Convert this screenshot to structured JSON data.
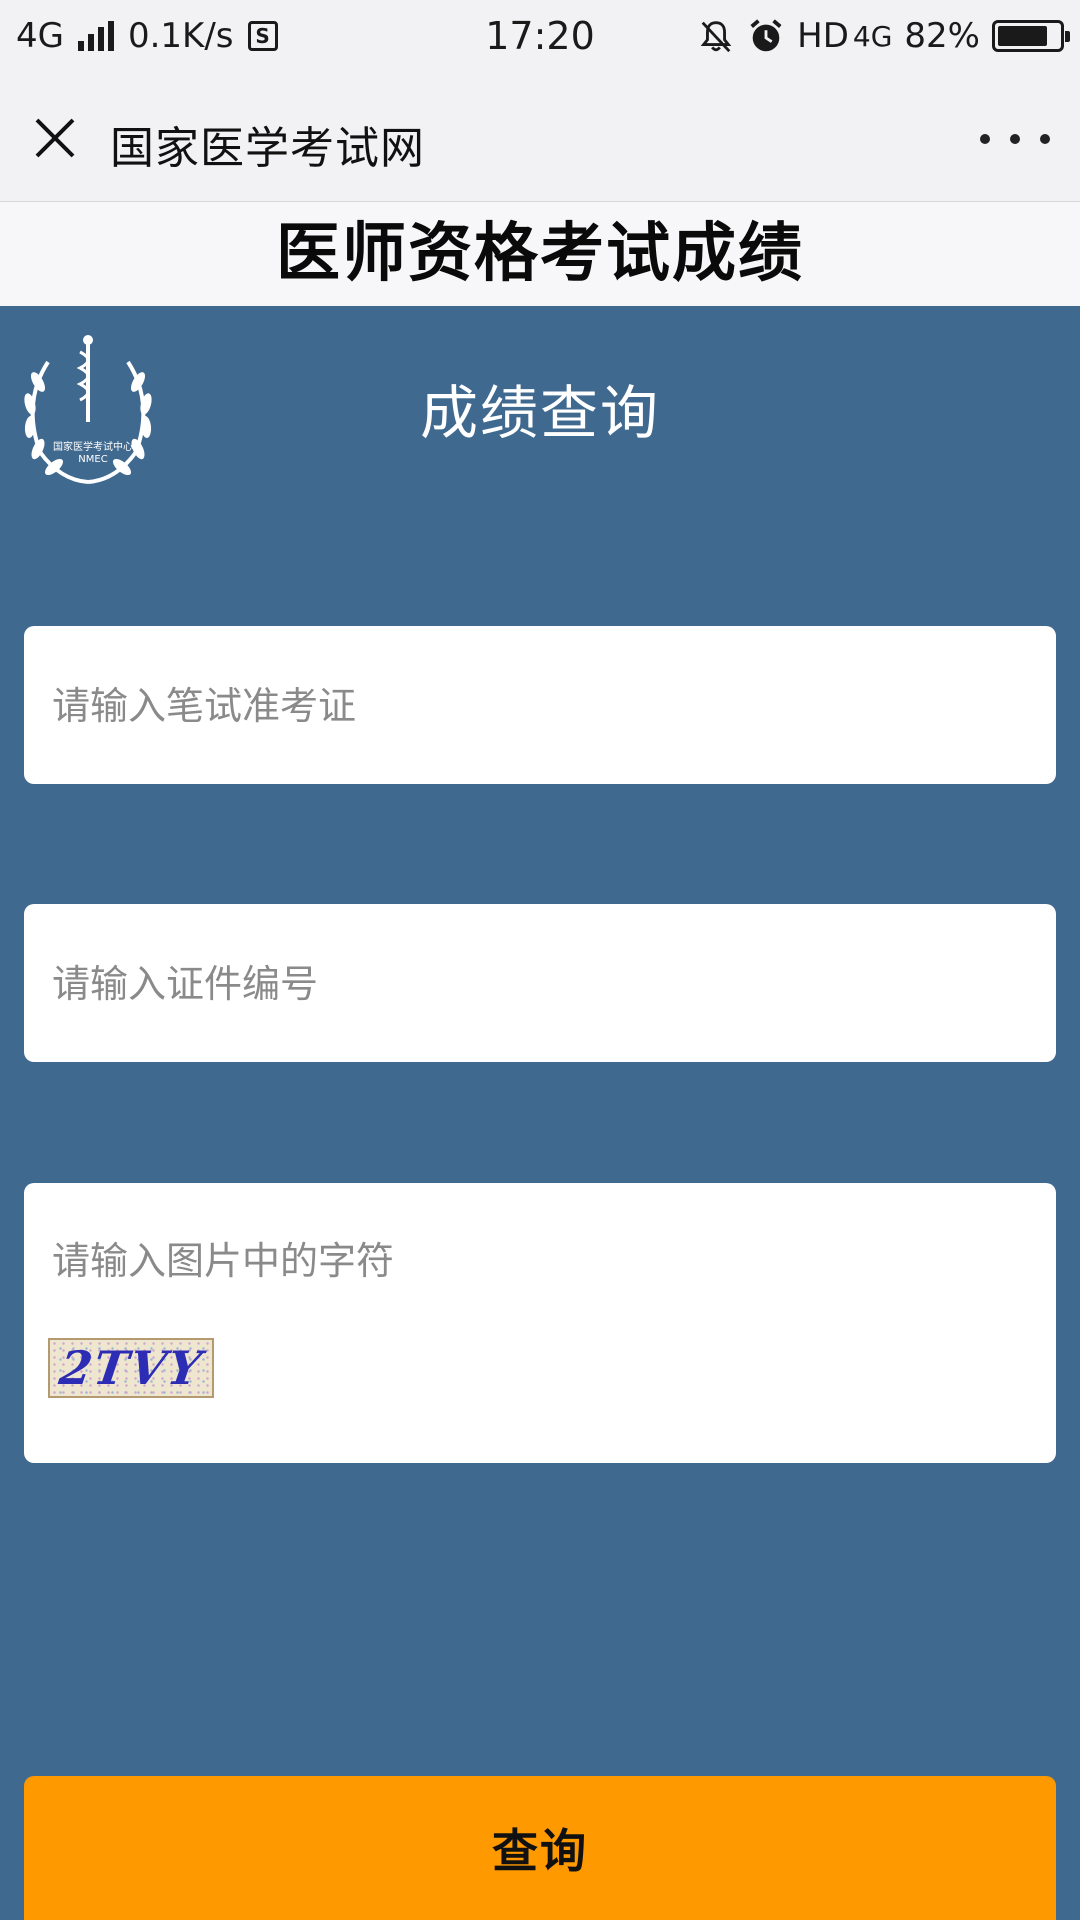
{
  "status_bar": {
    "network": "4G",
    "speed": "0.1K/s",
    "s_badge": "S",
    "time": "17:20",
    "hd": "HD",
    "network_right": "4G",
    "battery": "82%",
    "battery_level": 0.82,
    "icons": [
      "signal-icon",
      "sim-icon",
      "mute-icon",
      "alarm-icon",
      "battery-icon"
    ]
  },
  "nav": {
    "title": "国家医学考试网",
    "close_icon": "close-icon",
    "more_icon": "more-icon"
  },
  "header": {
    "title": "医师资格考试成绩"
  },
  "panel": {
    "logo_text_1": "国家医学考试中心",
    "logo_text_2": "NMEC",
    "title": "成绩查询",
    "exam_ticket_placeholder": "请输入笔试准考证",
    "id_number_placeholder": "请输入证件编号",
    "captcha_placeholder": "请输入图片中的字符",
    "captcha_code": "2TVY",
    "query_button": "查询"
  },
  "colors": {
    "background": "#40698f",
    "button": "#ff9900",
    "field": "#ffffff"
  }
}
